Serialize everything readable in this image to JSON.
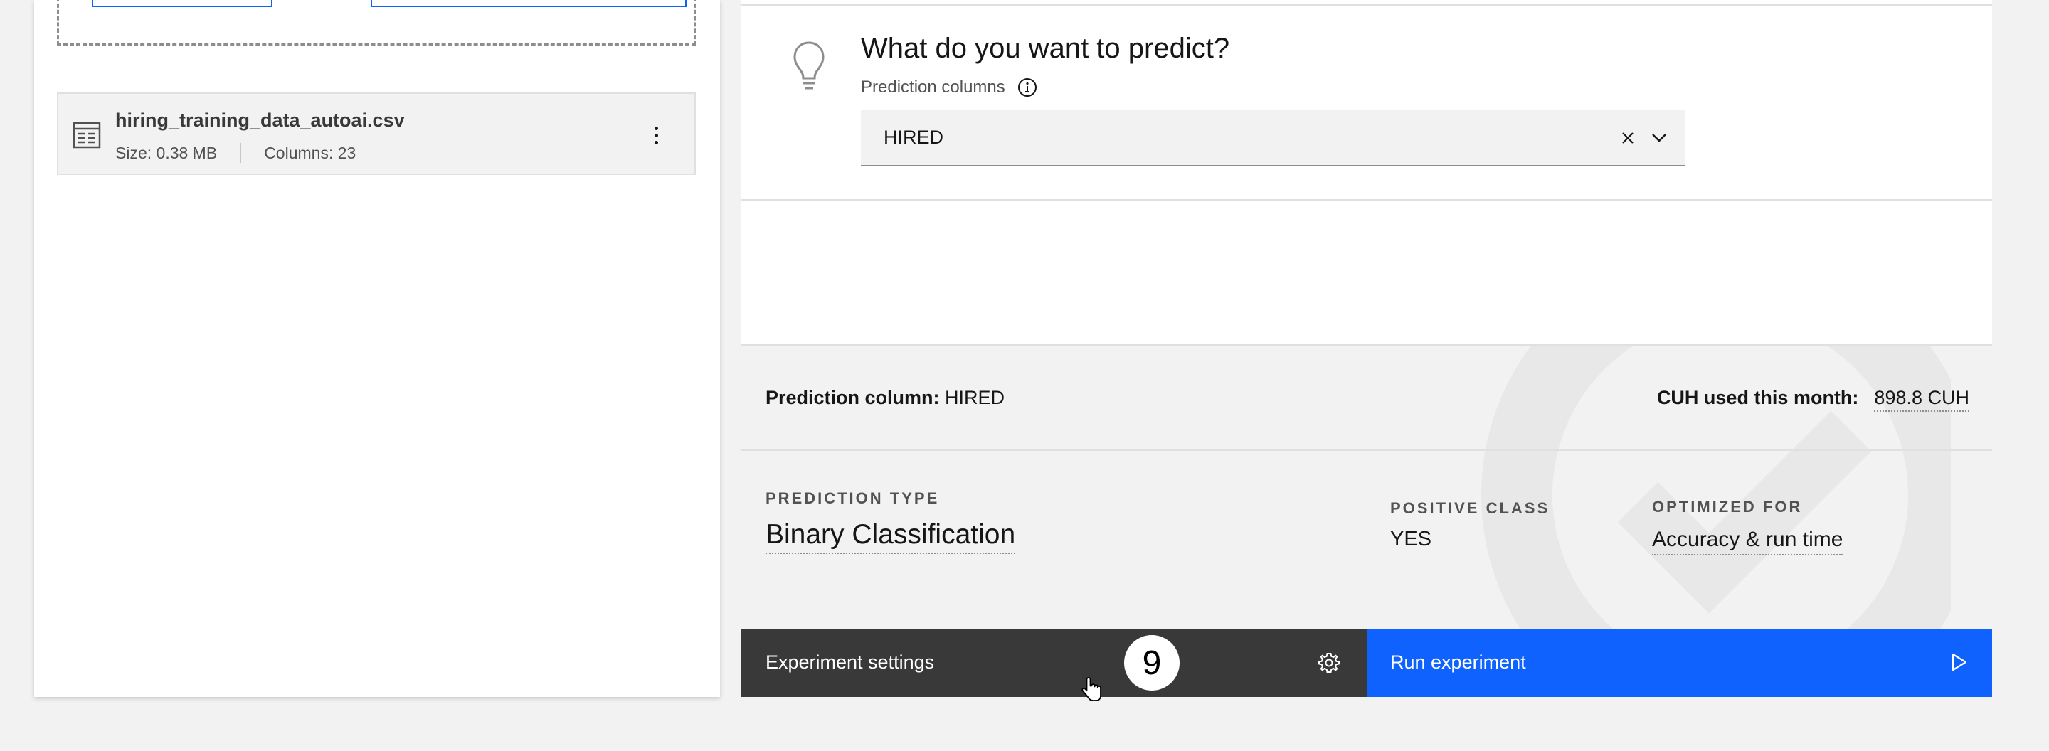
{
  "file": {
    "name": "hiring_training_data_autoai.csv",
    "size": "Size: 0.38 MB",
    "columns": "Columns: 23"
  },
  "predict": {
    "title": "What do you want to predict?",
    "subtitle": "Prediction columns",
    "selected_value": "HIRED"
  },
  "summary": {
    "prediction_column_label": "Prediction column:",
    "prediction_column_value": "HIRED",
    "cuh_label": "CUH used this month:",
    "cuh_value": "898.8 CUH",
    "prediction_type_label": "PREDICTION TYPE",
    "prediction_type_value": "Binary Classification",
    "positive_class_label": "POSITIVE CLASS",
    "positive_class_value": "YES",
    "optimized_for_label": "OPTIMIZED FOR",
    "optimized_for_value": "Accuracy & run time"
  },
  "actions": {
    "settings_label": "Experiment settings",
    "run_label": "Run experiment"
  },
  "step_badge": "9",
  "colors": {
    "primary": "#0f62fe",
    "settings_bg": "#393939",
    "panel_bg": "#f2f2f2"
  },
  "icons": [
    "table-icon",
    "overflow-menu-icon",
    "lightbulb-icon",
    "info-icon",
    "close-icon",
    "chevron-down-icon",
    "gear-icon",
    "play-icon",
    "pointer-cursor-icon"
  ]
}
